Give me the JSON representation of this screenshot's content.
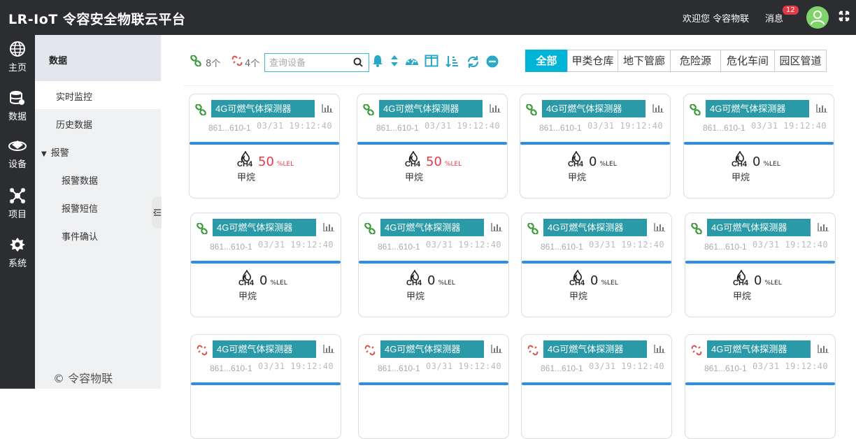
{
  "header": {
    "brand": "LR-IoT 令容安全物联云平台",
    "welcome": "欢迎您 令容物联",
    "messages_label": "消息",
    "messages_count": "12"
  },
  "rail": [
    {
      "label": "主页",
      "icon": "globe-icon"
    },
    {
      "label": "数据",
      "icon": "database-icon"
    },
    {
      "label": "设备",
      "icon": "device-icon"
    },
    {
      "label": "项目",
      "icon": "project-icon"
    },
    {
      "label": "系统",
      "icon": "settings-icon"
    }
  ],
  "sidebar": {
    "heading": "数据",
    "items": [
      "实时监控",
      "历史数据",
      "报警",
      "报警数据",
      "报警短信",
      "事件确认"
    ],
    "copyright": "© 令容物联"
  },
  "toolbar": {
    "online_count": "8个",
    "offline_count": "4个",
    "search_placeholder": "查询设备"
  },
  "tabs": [
    "全部",
    "甲类仓库",
    "地下管廊",
    "危险源",
    "危化车间",
    "园区管道"
  ],
  "colors": {
    "accent": "#00b4d8",
    "card_title": "#2a9aa8",
    "alarm": "#e63946",
    "online": "#3a9a3a",
    "offline": "#d9534f"
  },
  "devices": [
    {
      "name": "4G可燃气体探测器",
      "id": "861...610-1",
      "time": "03/31 19:12:40",
      "gas": "CH4",
      "value": "50",
      "unit": "%LEL",
      "label": "甲烷",
      "online": true
    },
    {
      "name": "4G可燃气体探测器",
      "id": "861...610-1",
      "time": "03/31 19:12:40",
      "gas": "CH4",
      "value": "50",
      "unit": "%LEL",
      "label": "甲烷",
      "online": true
    },
    {
      "name": "4G可燃气体探测器",
      "id": "861...610-1",
      "time": "03/31 19:12:40",
      "gas": "CH4",
      "value": "0",
      "unit": "%LEL",
      "label": "甲烷",
      "online": true
    },
    {
      "name": "4G可燃气体探测器",
      "id": "861...610-1",
      "time": "03/31 19:12:40",
      "gas": "CH4",
      "value": "0",
      "unit": "%LEL",
      "label": "甲烷",
      "online": true
    },
    {
      "name": "4G可燃气体探测器",
      "id": "861...610-1",
      "time": "03/31 19:12:40",
      "gas": "CH4",
      "value": "0",
      "unit": "%LEL",
      "label": "甲烷",
      "online": true
    },
    {
      "name": "4G可燃气体探测器",
      "id": "861...610-1",
      "time": "03/31 19:12:40",
      "gas": "CH4",
      "value": "0",
      "unit": "%LEL",
      "label": "甲烷",
      "online": true
    },
    {
      "name": "4G可燃气体探测器",
      "id": "861...610-1",
      "time": "03/31 19:12:40",
      "gas": "CH4",
      "value": "0",
      "unit": "%LEL",
      "label": "甲烷",
      "online": true
    },
    {
      "name": "4G可燃气体探测器",
      "id": "861...610-1",
      "time": "03/31 19:12:40",
      "gas": "CH4",
      "value": "0",
      "unit": "%LEL",
      "label": "甲烷",
      "online": true
    },
    {
      "name": "4G可燃气体探测器",
      "id": "861...610-1",
      "time": "03/31 19:12:40",
      "online": false
    },
    {
      "name": "4G可燃气体探测器",
      "id": "861...610-1",
      "time": "03/31 19:12:40",
      "online": false
    },
    {
      "name": "4G可燃气体探测器",
      "id": "861...610-1",
      "time": "03/31 19:12:40",
      "online": false
    },
    {
      "name": "4G可燃气体探测器",
      "id": "861...610-1",
      "time": "03/31 19:12:40",
      "online": false
    }
  ]
}
